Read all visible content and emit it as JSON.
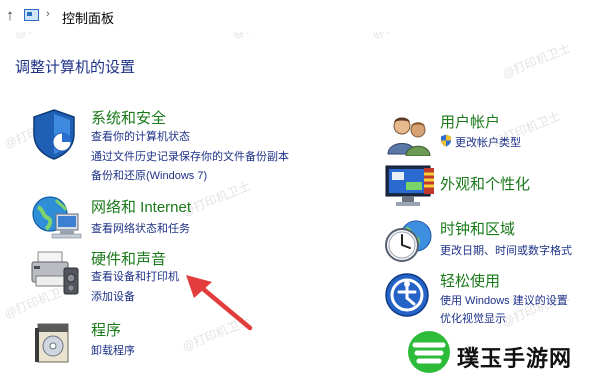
{
  "address_bar": {
    "up_arrow": "↑",
    "separator": "›",
    "breadcrumb": "控制面板"
  },
  "page_title": "调整计算机的设置",
  "categories_left": [
    {
      "icon": "security-shield-icon",
      "title": "系统和安全",
      "links": [
        "查看你的计算机状态",
        "通过文件历史记录保存你的文件备份副本",
        "备份和还原(Windows 7)"
      ]
    },
    {
      "icon": "network-globe-icon",
      "title": "网络和 Internet",
      "links": [
        "查看网络状态和任务"
      ]
    },
    {
      "icon": "printer-icon",
      "title": "硬件和声音",
      "links": [
        "查看设备和打印机",
        "添加设备"
      ]
    },
    {
      "icon": "programs-disc-icon",
      "title": "程序",
      "links": [
        "卸载程序"
      ]
    }
  ],
  "categories_right": [
    {
      "icon": "user-accounts-icon",
      "title": "用户帐户",
      "links": [
        "更改帐户类型"
      ]
    },
    {
      "icon": "appearance-monitor-icon",
      "title": "外观和个性化",
      "links": []
    },
    {
      "icon": "clock-globe-icon",
      "title": "时钟和区域",
      "links": [
        "更改日期、时间或数字格式"
      ]
    },
    {
      "icon": "ease-of-access-icon",
      "title": "轻松使用",
      "links": [
        "使用 Windows 建议的设置",
        "优化视觉显示"
      ]
    }
  ],
  "brand_text": "璞玉手游网",
  "watermark_text": "@打印机卫士",
  "colors": {
    "link": "#1e3287",
    "category_title": "#1a7a1a",
    "arrow": "#e23c3c",
    "brand_green": "#2dbb3a"
  }
}
